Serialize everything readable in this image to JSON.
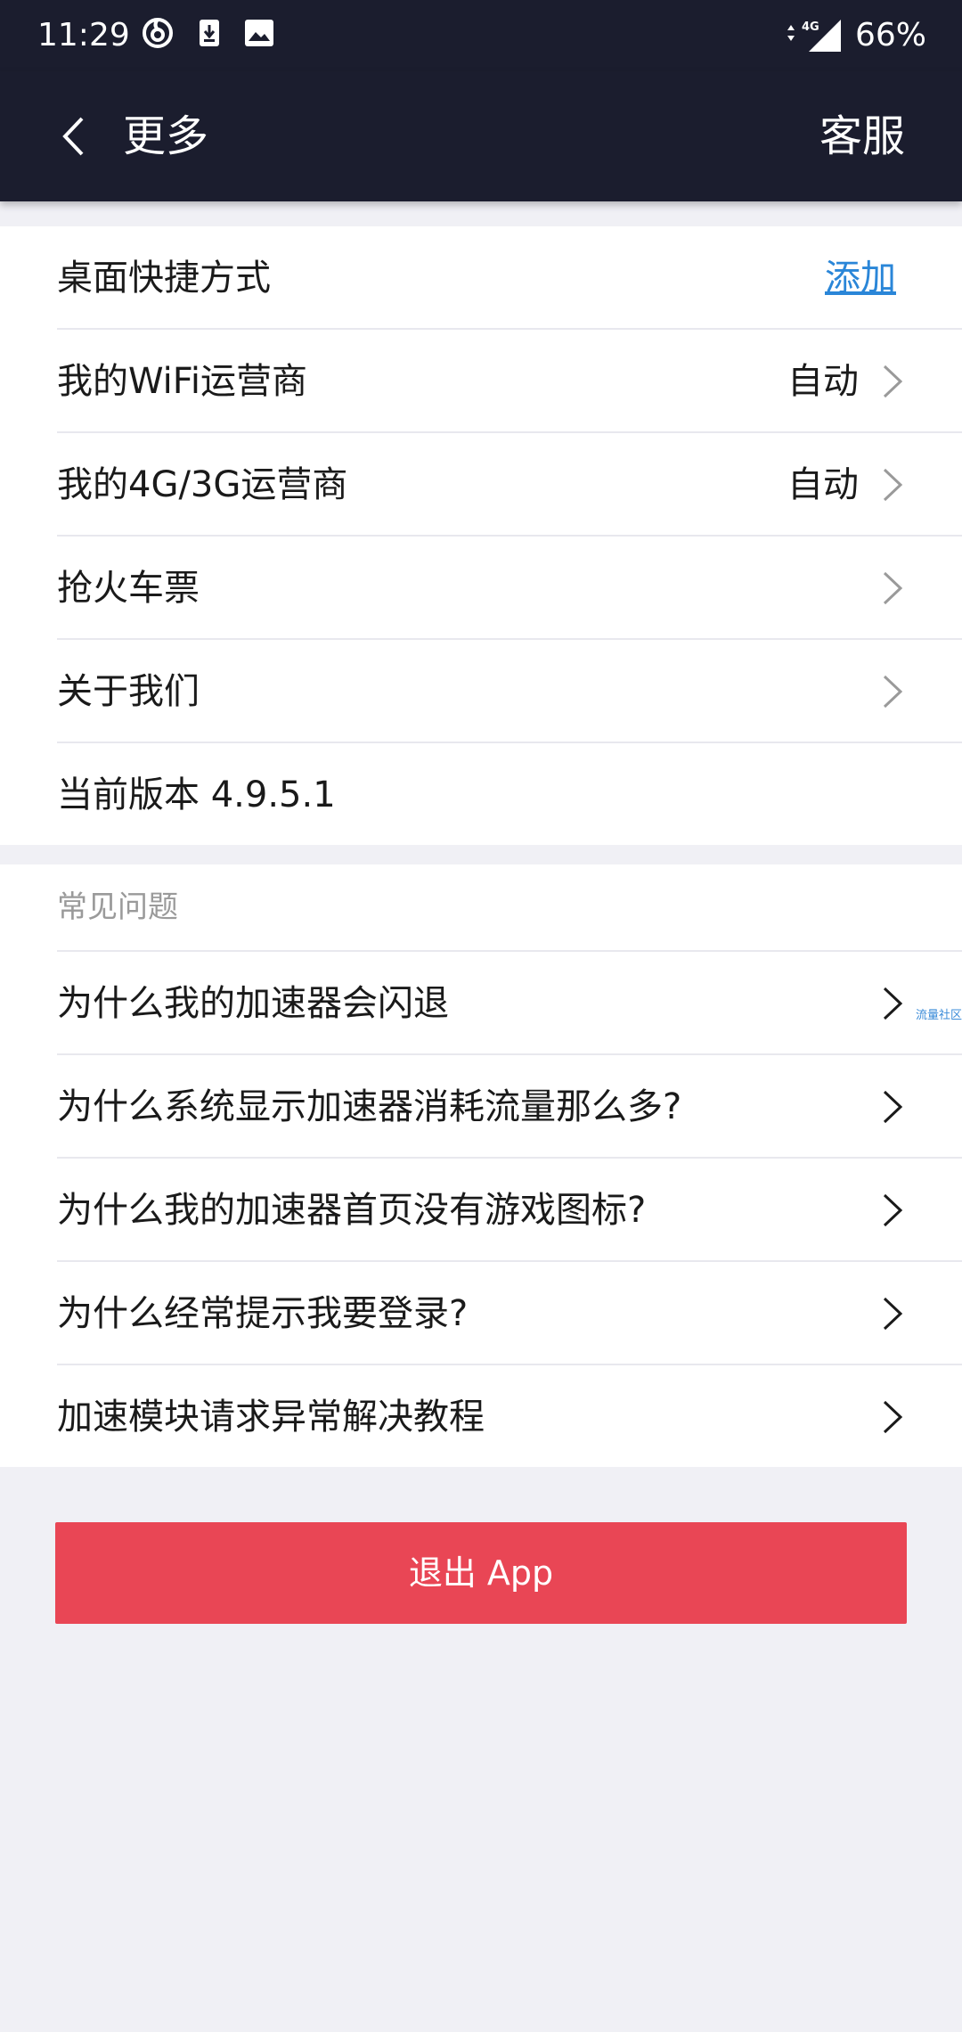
{
  "status_bar": {
    "time": "11:29",
    "network": "4G",
    "battery": "66%"
  },
  "app_bar": {
    "title": "更多",
    "service_label": "客服"
  },
  "settings": {
    "shortcut": {
      "label": "桌面快捷方式",
      "action": "添加"
    },
    "wifi_operator": {
      "label": "我的WiFi运营商",
      "value": "自动"
    },
    "mobile_operator": {
      "label": "我的4G/3G运营商",
      "value": "自动"
    },
    "train_tickets": {
      "label": "抢火车票"
    },
    "about": {
      "label": "关于我们"
    },
    "version": {
      "label": "当前版本 4.9.5.1"
    }
  },
  "faq": {
    "header": "常见问题",
    "items": [
      {
        "label": "为什么我的加速器会闪退"
      },
      {
        "label": "为什么系统显示加速器消耗流量那么多?"
      },
      {
        "label": "为什么我的加速器首页没有游戏图标?"
      },
      {
        "label": "为什么经常提示我要登录?"
      },
      {
        "label": "加速模块请求异常解决教程"
      }
    ]
  },
  "side_tag": "流量社区",
  "logout_label": "退出 App",
  "colors": {
    "header_bg": "#1b1d2e",
    "link": "#2a86d8",
    "logout": "#e94655",
    "page_bg": "#f0f0f5"
  },
  "icons": {
    "back": "chevron-left-icon",
    "row_arrow": "chevron-right-icon"
  }
}
